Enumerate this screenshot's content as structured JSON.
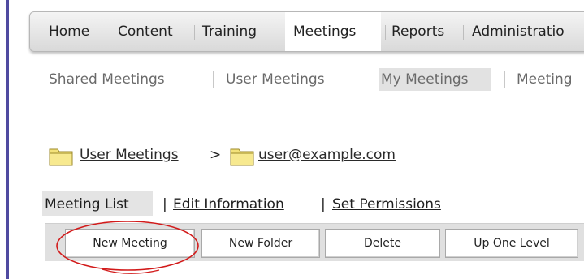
{
  "main_nav": {
    "items": [
      "Home",
      "Content",
      "Training",
      "Meetings",
      "Reports",
      "Administratio"
    ],
    "active": "Meetings"
  },
  "sub_nav": {
    "items": [
      "Shared Meetings",
      "User Meetings",
      "My Meetings",
      "Meeting"
    ],
    "active": "My Meetings"
  },
  "breadcrumb": {
    "first": "User Meetings",
    "separator": ">",
    "second": "user@example.com",
    "folder_icon": "folder-icon",
    "folder_color": "#f3e27a"
  },
  "tabs": {
    "items": [
      "Meeting List",
      "Edit Information",
      "Set Permissions"
    ],
    "separator": "|",
    "active": "Meeting List"
  },
  "toolbar": {
    "buttons": [
      "New Meeting",
      "New Folder",
      "Delete",
      "Up One Level"
    ]
  },
  "annotation": {
    "highlight_color": "#d21a1a"
  }
}
